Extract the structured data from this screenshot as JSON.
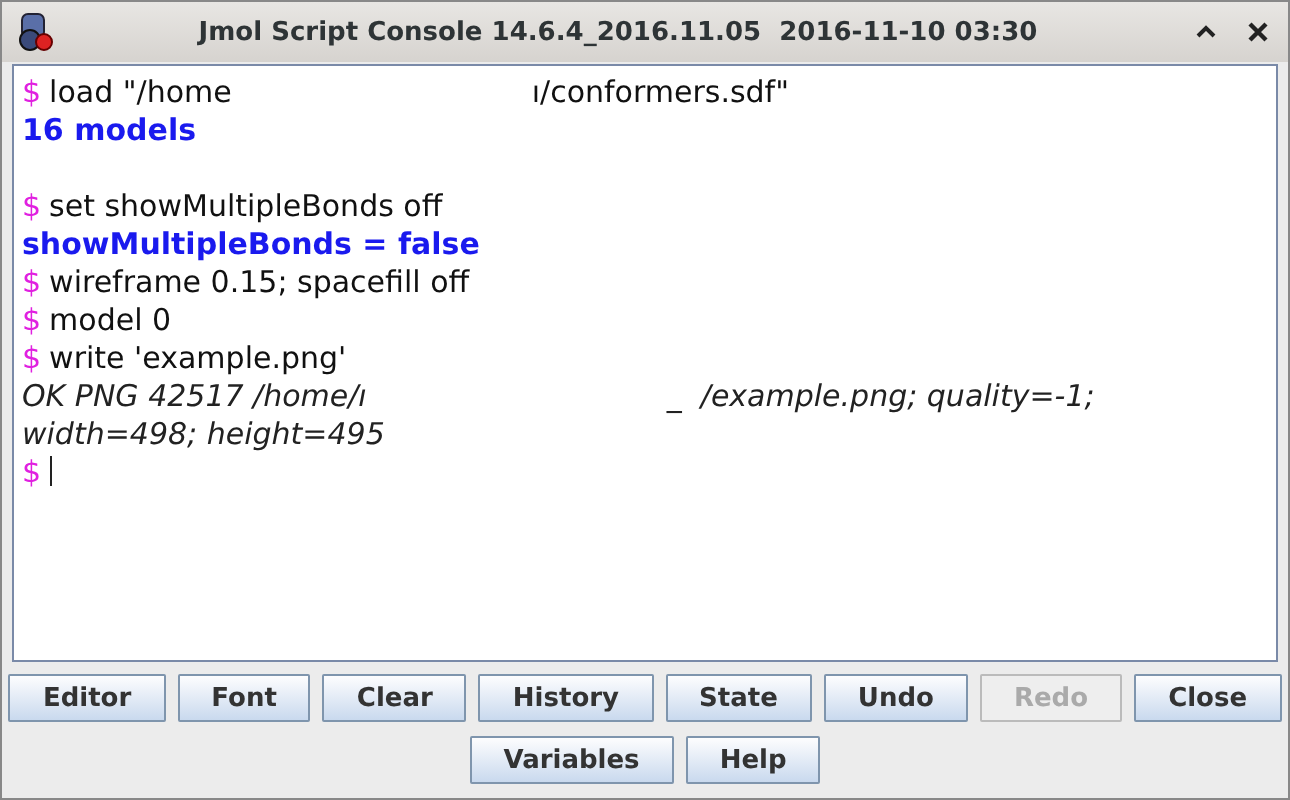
{
  "window": {
    "title": "Jmol Script Console 14.6.4_2016.11.05  2016-11-10 03:30"
  },
  "console": {
    "lines": [
      {
        "kind": "command",
        "prompt": "$",
        "parts": [
          "load \"/home",
          "ı/conformers.sdf\""
        ]
      },
      {
        "kind": "result",
        "parts": [
          "16 models"
        ]
      },
      {
        "kind": "blank"
      },
      {
        "kind": "command",
        "prompt": "$",
        "parts": [
          "set showMultipleBonds off"
        ]
      },
      {
        "kind": "result",
        "parts": [
          "showMultipleBonds = false"
        ]
      },
      {
        "kind": "command",
        "prompt": "$",
        "parts": [
          "wireframe 0.15; spacefill off"
        ]
      },
      {
        "kind": "command",
        "prompt": "$",
        "parts": [
          "model 0"
        ]
      },
      {
        "kind": "command",
        "prompt": "$",
        "parts": [
          "write 'example.png'"
        ]
      },
      {
        "kind": "echo",
        "parts": [
          "OK PNG 42517 /home/ı",
          "_  /example.png; quality=-1;"
        ]
      },
      {
        "kind": "echo",
        "parts": [
          "width=498; height=495"
        ]
      },
      {
        "kind": "input",
        "prompt": "$"
      }
    ]
  },
  "buttons": [
    [
      {
        "label": "Editor",
        "disabled": false
      },
      {
        "label": "Font",
        "disabled": false
      },
      {
        "label": "Clear",
        "disabled": false
      },
      {
        "label": "History",
        "disabled": false
      },
      {
        "label": "State",
        "disabled": false
      },
      {
        "label": "Undo",
        "disabled": false
      },
      {
        "label": "Redo",
        "disabled": true
      },
      {
        "label": "Close",
        "disabled": false
      }
    ],
    [
      {
        "label": "Variables",
        "disabled": false
      },
      {
        "label": "Help",
        "disabled": false
      }
    ]
  ]
}
